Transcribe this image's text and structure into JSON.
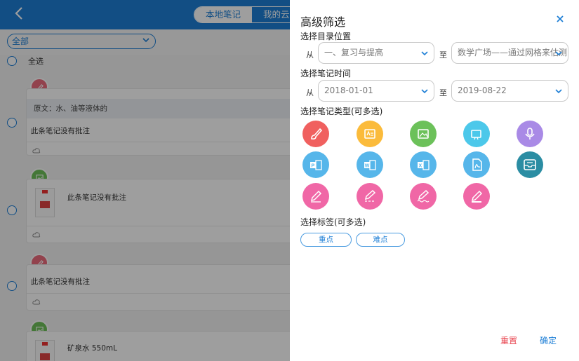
{
  "background": {
    "tabs": [
      {
        "label": "本地笔记",
        "active": true
      },
      {
        "label": "我的云",
        "active": false
      }
    ],
    "scope_dropdown": {
      "value": "全部"
    },
    "select_all_label": "全选",
    "notes": [
      {
        "type_icon": "pen-icon",
        "type_color": "#ec6b7c",
        "quote": "原文：水、油等液体的",
        "comment": "此条笔记没有批注"
      },
      {
        "type_icon": "image-icon",
        "type_color": "#6ec05a",
        "comment": "此条笔记没有批注"
      },
      {
        "type_icon": "pen-icon",
        "type_color": "#ec6b7c",
        "comment": "此条笔记没有批注"
      },
      {
        "type_icon": "image-icon",
        "type_color": "#6ec05a",
        "comment": "矿泉水 550mL"
      }
    ]
  },
  "panel": {
    "title": "高级筛选",
    "close_icon": "close-icon",
    "catalog": {
      "label": "选择目录位置",
      "from_label": "从",
      "from_value": "一、复习与提高",
      "to_label": "至",
      "to_value": "数学广场——通过网格来估测"
    },
    "time": {
      "label": "选择笔记时间",
      "from_label": "从",
      "from_value": "2018-01-01",
      "to_label": "至",
      "to_value": "2019-08-22"
    },
    "types": {
      "label": "选择笔记类型(可多选)",
      "items": [
        {
          "name": "brush-note-icon",
          "color": "#f0605f"
        },
        {
          "name": "text-note-icon",
          "color": "#fbbb3b"
        },
        {
          "name": "image-note-icon",
          "color": "#6cc15a"
        },
        {
          "name": "video-note-icon",
          "color": "#4cc8ea"
        },
        {
          "name": "audio-note-icon",
          "color": "#a98ae6"
        },
        {
          "name": "ppt-note-icon",
          "color": "#56b6ea"
        },
        {
          "name": "word-note-icon",
          "color": "#56b6ea"
        },
        {
          "name": "excel-note-icon",
          "color": "#56b6ea"
        },
        {
          "name": "pdf-note-icon",
          "color": "#56b6ea"
        },
        {
          "name": "tray-note-icon",
          "color": "#2b8da3"
        },
        {
          "name": "pencil-note-icon",
          "color": "#f067a6"
        },
        {
          "name": "pencil-dash-note-icon",
          "color": "#f067a6"
        },
        {
          "name": "pencil-wave-note-icon",
          "color": "#f067a6"
        },
        {
          "name": "eraser-note-icon",
          "color": "#f067a6"
        }
      ]
    },
    "tags": {
      "label": "选择标签(可多选)",
      "items": [
        "重点",
        "难点"
      ]
    },
    "reset_label": "重置",
    "confirm_label": "确定"
  }
}
